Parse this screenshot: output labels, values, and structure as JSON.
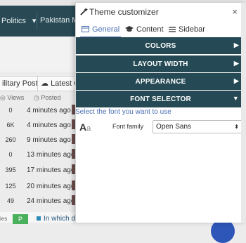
{
  "background": {
    "nav": {
      "item_politics": "Politics",
      "item_pakistan": "Pakistan Mi",
      "caret": "▾"
    },
    "tabs": {
      "tab1": "ilitary Posts",
      "tab2": "Latest C"
    },
    "headers": {
      "views": "Views",
      "posted": "Posted"
    },
    "rows": [
      {
        "views": "0",
        "time": "4 minutes ago"
      },
      {
        "views": "6K",
        "time": "4 minutes ago"
      },
      {
        "views": "260",
        "time": "9 minutes ago"
      },
      {
        "views": "0",
        "time": "13 minutes ago"
      },
      {
        "views": "395",
        "time": "17 minutes ago"
      },
      {
        "views": "125",
        "time": "20 minutes ago"
      },
      {
        "views": "49",
        "time": "24 minutes ago"
      }
    ],
    "bottom": {
      "left": "ies",
      "badge": "P",
      "text": "In which de"
    }
  },
  "customizer": {
    "title": "Theme customizer",
    "close": "×",
    "tabs": [
      {
        "label": "General",
        "icon": "card-icon"
      },
      {
        "label": "Content",
        "icon": "graduation-cap-icon"
      },
      {
        "label": "Sidebar",
        "icon": "menu-icon"
      }
    ],
    "sections": [
      {
        "label": "COLORS",
        "arrow": "▶"
      },
      {
        "label": "LAYOUT WIDTH",
        "arrow": "▶"
      },
      {
        "label": "APPEARANCE",
        "arrow": "▶"
      },
      {
        "label": "FONT SELECTOR",
        "arrow": "▼"
      }
    ],
    "font": {
      "description": "Select the font you want to use",
      "icon_text": "A",
      "icon_text_small": "a",
      "label": "Font family",
      "value": "Open Sans",
      "chevron": "⬍"
    },
    "accent_color": "#4a6fb0",
    "header_color": "#264a55"
  }
}
